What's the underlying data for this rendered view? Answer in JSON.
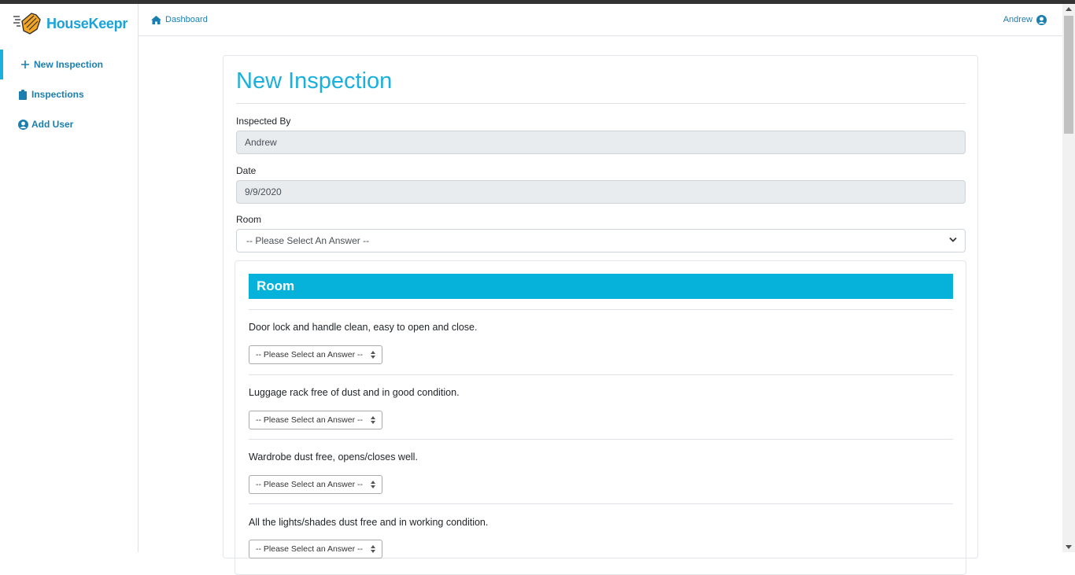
{
  "app": {
    "logo_text": "HouseKeepr"
  },
  "sidebar": {
    "items": [
      {
        "label": "New Inspection",
        "icon": "plus-icon"
      },
      {
        "label": "Inspections",
        "icon": "clipboard-icon"
      },
      {
        "label": "Add User",
        "icon": "user-circle-icon"
      }
    ]
  },
  "header": {
    "breadcrumb": "Dashboard",
    "user_name": "Andrew"
  },
  "form": {
    "title": "New Inspection",
    "inspected_by_label": "Inspected By",
    "inspected_by_value": "Andrew",
    "date_label": "Date",
    "date_value": "9/9/2020",
    "room_label": "Room",
    "room_selected": "-- Please Select An Answer --"
  },
  "section": {
    "title": "Room",
    "questions": [
      {
        "text": "Door lock and handle clean, easy to open and close.",
        "answer": "-- Please Select an Answer --"
      },
      {
        "text": "Luggage rack free of dust and in good condition.",
        "answer": "-- Please Select an Answer --"
      },
      {
        "text": "Wardrobe dust free, opens/closes well.",
        "answer": "-- Please Select an Answer --"
      },
      {
        "text": "All the lights/shades dust free and in working condition.",
        "answer": "-- Please Select an Answer --"
      }
    ]
  },
  "colors": {
    "accent": "#1ab0dd",
    "section_header": "#06b1da",
    "link": "#1a7fb0"
  }
}
